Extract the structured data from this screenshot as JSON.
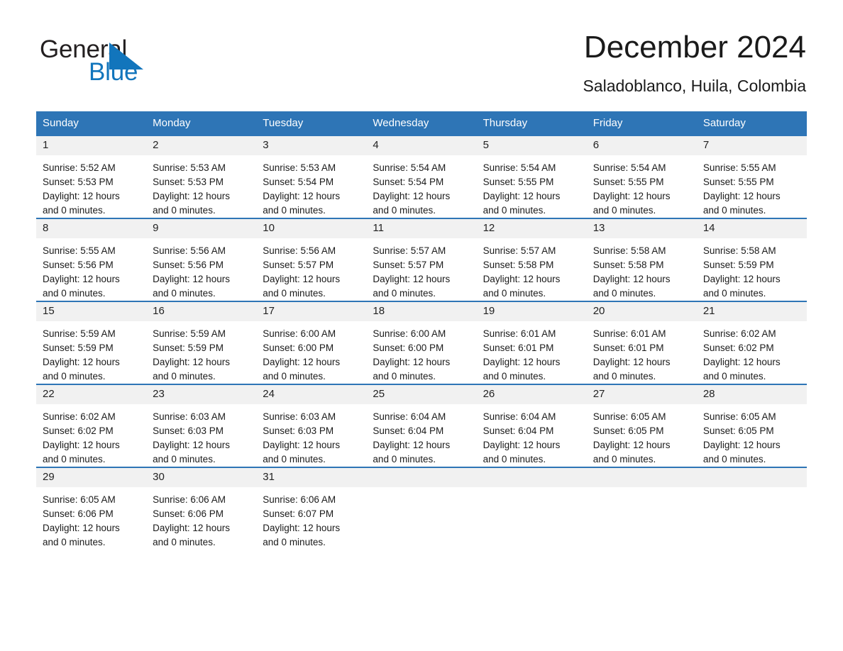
{
  "brand": {
    "name_part1": "General",
    "name_part2": "Blue",
    "triangle_color": "#1275bc",
    "text_color": "#231f20"
  },
  "header": {
    "title": "December 2024",
    "subtitle": "Saladoblanco, Huila, Colombia"
  },
  "theme": {
    "header_blue": "#2e75b6",
    "daynum_band": "#f1f1f1",
    "page_background": "#ffffff",
    "text": "#1a1a1a"
  },
  "calendar": {
    "weekday_headers": [
      "Sunday",
      "Monday",
      "Tuesday",
      "Wednesday",
      "Thursday",
      "Friday",
      "Saturday"
    ],
    "weeks": [
      [
        {
          "day": "1",
          "sunrise": "Sunrise: 5:52 AM",
          "sunset": "Sunset: 5:53 PM",
          "daylight_line1": "Daylight: 12 hours",
          "daylight_line2": "and 0 minutes."
        },
        {
          "day": "2",
          "sunrise": "Sunrise: 5:53 AM",
          "sunset": "Sunset: 5:53 PM",
          "daylight_line1": "Daylight: 12 hours",
          "daylight_line2": "and 0 minutes."
        },
        {
          "day": "3",
          "sunrise": "Sunrise: 5:53 AM",
          "sunset": "Sunset: 5:54 PM",
          "daylight_line1": "Daylight: 12 hours",
          "daylight_line2": "and 0 minutes."
        },
        {
          "day": "4",
          "sunrise": "Sunrise: 5:54 AM",
          "sunset": "Sunset: 5:54 PM",
          "daylight_line1": "Daylight: 12 hours",
          "daylight_line2": "and 0 minutes."
        },
        {
          "day": "5",
          "sunrise": "Sunrise: 5:54 AM",
          "sunset": "Sunset: 5:55 PM",
          "daylight_line1": "Daylight: 12 hours",
          "daylight_line2": "and 0 minutes."
        },
        {
          "day": "6",
          "sunrise": "Sunrise: 5:54 AM",
          "sunset": "Sunset: 5:55 PM",
          "daylight_line1": "Daylight: 12 hours",
          "daylight_line2": "and 0 minutes."
        },
        {
          "day": "7",
          "sunrise": "Sunrise: 5:55 AM",
          "sunset": "Sunset: 5:55 PM",
          "daylight_line1": "Daylight: 12 hours",
          "daylight_line2": "and 0 minutes."
        }
      ],
      [
        {
          "day": "8",
          "sunrise": "Sunrise: 5:55 AM",
          "sunset": "Sunset: 5:56 PM",
          "daylight_line1": "Daylight: 12 hours",
          "daylight_line2": "and 0 minutes."
        },
        {
          "day": "9",
          "sunrise": "Sunrise: 5:56 AM",
          "sunset": "Sunset: 5:56 PM",
          "daylight_line1": "Daylight: 12 hours",
          "daylight_line2": "and 0 minutes."
        },
        {
          "day": "10",
          "sunrise": "Sunrise: 5:56 AM",
          "sunset": "Sunset: 5:57 PM",
          "daylight_line1": "Daylight: 12 hours",
          "daylight_line2": "and 0 minutes."
        },
        {
          "day": "11",
          "sunrise": "Sunrise: 5:57 AM",
          "sunset": "Sunset: 5:57 PM",
          "daylight_line1": "Daylight: 12 hours",
          "daylight_line2": "and 0 minutes."
        },
        {
          "day": "12",
          "sunrise": "Sunrise: 5:57 AM",
          "sunset": "Sunset: 5:58 PM",
          "daylight_line1": "Daylight: 12 hours",
          "daylight_line2": "and 0 minutes."
        },
        {
          "day": "13",
          "sunrise": "Sunrise: 5:58 AM",
          "sunset": "Sunset: 5:58 PM",
          "daylight_line1": "Daylight: 12 hours",
          "daylight_line2": "and 0 minutes."
        },
        {
          "day": "14",
          "sunrise": "Sunrise: 5:58 AM",
          "sunset": "Sunset: 5:59 PM",
          "daylight_line1": "Daylight: 12 hours",
          "daylight_line2": "and 0 minutes."
        }
      ],
      [
        {
          "day": "15",
          "sunrise": "Sunrise: 5:59 AM",
          "sunset": "Sunset: 5:59 PM",
          "daylight_line1": "Daylight: 12 hours",
          "daylight_line2": "and 0 minutes."
        },
        {
          "day": "16",
          "sunrise": "Sunrise: 5:59 AM",
          "sunset": "Sunset: 5:59 PM",
          "daylight_line1": "Daylight: 12 hours",
          "daylight_line2": "and 0 minutes."
        },
        {
          "day": "17",
          "sunrise": "Sunrise: 6:00 AM",
          "sunset": "Sunset: 6:00 PM",
          "daylight_line1": "Daylight: 12 hours",
          "daylight_line2": "and 0 minutes."
        },
        {
          "day": "18",
          "sunrise": "Sunrise: 6:00 AM",
          "sunset": "Sunset: 6:00 PM",
          "daylight_line1": "Daylight: 12 hours",
          "daylight_line2": "and 0 minutes."
        },
        {
          "day": "19",
          "sunrise": "Sunrise: 6:01 AM",
          "sunset": "Sunset: 6:01 PM",
          "daylight_line1": "Daylight: 12 hours",
          "daylight_line2": "and 0 minutes."
        },
        {
          "day": "20",
          "sunrise": "Sunrise: 6:01 AM",
          "sunset": "Sunset: 6:01 PM",
          "daylight_line1": "Daylight: 12 hours",
          "daylight_line2": "and 0 minutes."
        },
        {
          "day": "21",
          "sunrise": "Sunrise: 6:02 AM",
          "sunset": "Sunset: 6:02 PM",
          "daylight_line1": "Daylight: 12 hours",
          "daylight_line2": "and 0 minutes."
        }
      ],
      [
        {
          "day": "22",
          "sunrise": "Sunrise: 6:02 AM",
          "sunset": "Sunset: 6:02 PM",
          "daylight_line1": "Daylight: 12 hours",
          "daylight_line2": "and 0 minutes."
        },
        {
          "day": "23",
          "sunrise": "Sunrise: 6:03 AM",
          "sunset": "Sunset: 6:03 PM",
          "daylight_line1": "Daylight: 12 hours",
          "daylight_line2": "and 0 minutes."
        },
        {
          "day": "24",
          "sunrise": "Sunrise: 6:03 AM",
          "sunset": "Sunset: 6:03 PM",
          "daylight_line1": "Daylight: 12 hours",
          "daylight_line2": "and 0 minutes."
        },
        {
          "day": "25",
          "sunrise": "Sunrise: 6:04 AM",
          "sunset": "Sunset: 6:04 PM",
          "daylight_line1": "Daylight: 12 hours",
          "daylight_line2": "and 0 minutes."
        },
        {
          "day": "26",
          "sunrise": "Sunrise: 6:04 AM",
          "sunset": "Sunset: 6:04 PM",
          "daylight_line1": "Daylight: 12 hours",
          "daylight_line2": "and 0 minutes."
        },
        {
          "day": "27",
          "sunrise": "Sunrise: 6:05 AM",
          "sunset": "Sunset: 6:05 PM",
          "daylight_line1": "Daylight: 12 hours",
          "daylight_line2": "and 0 minutes."
        },
        {
          "day": "28",
          "sunrise": "Sunrise: 6:05 AM",
          "sunset": "Sunset: 6:05 PM",
          "daylight_line1": "Daylight: 12 hours",
          "daylight_line2": "and 0 minutes."
        }
      ],
      [
        {
          "day": "29",
          "sunrise": "Sunrise: 6:05 AM",
          "sunset": "Sunset: 6:06 PM",
          "daylight_line1": "Daylight: 12 hours",
          "daylight_line2": "and 0 minutes."
        },
        {
          "day": "30",
          "sunrise": "Sunrise: 6:06 AM",
          "sunset": "Sunset: 6:06 PM",
          "daylight_line1": "Daylight: 12 hours",
          "daylight_line2": "and 0 minutes."
        },
        {
          "day": "31",
          "sunrise": "Sunrise: 6:06 AM",
          "sunset": "Sunset: 6:07 PM",
          "daylight_line1": "Daylight: 12 hours",
          "daylight_line2": "and 0 minutes."
        },
        {
          "day": "",
          "sunrise": "",
          "sunset": "",
          "daylight_line1": "",
          "daylight_line2": ""
        },
        {
          "day": "",
          "sunrise": "",
          "sunset": "",
          "daylight_line1": "",
          "daylight_line2": ""
        },
        {
          "day": "",
          "sunrise": "",
          "sunset": "",
          "daylight_line1": "",
          "daylight_line2": ""
        },
        {
          "day": "",
          "sunrise": "",
          "sunset": "",
          "daylight_line1": "",
          "daylight_line2": ""
        }
      ]
    ]
  }
}
